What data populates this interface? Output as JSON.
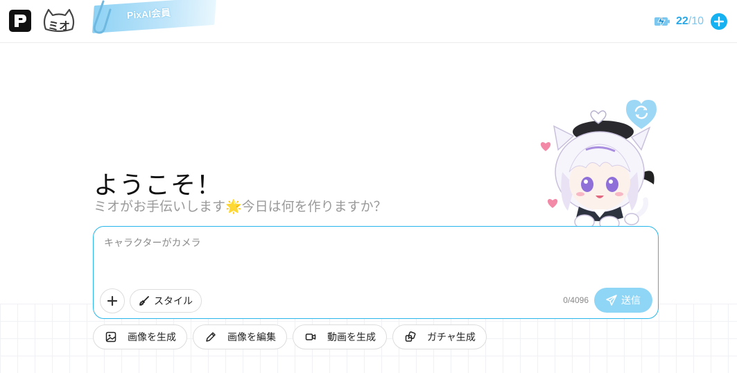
{
  "header": {
    "logo_icon": "pixai-logo-icon",
    "mascot_logo_text": "ミオ",
    "membership_badge": "PixAI会員",
    "credits": {
      "icon": "energy-bolt-icon",
      "current": "22",
      "separator": "/",
      "max": "10",
      "add_icon": "plus-icon"
    }
  },
  "welcome": {
    "title": "ようこそ！",
    "subtitle": "ミオがお手伝いします🌟今日は何を作りますか？"
  },
  "mascot": {
    "refresh_icon": "refresh-heart-icon"
  },
  "prompt": {
    "placeholder": "キャラクターがカメラ",
    "value": "",
    "add_icon": "plus-icon",
    "style_label": "スタイル",
    "style_icon": "brush-icon",
    "char_count": "0/4096",
    "send_label": "送信",
    "send_icon": "paper-plane-icon"
  },
  "actions": [
    {
      "label": "画像を生成",
      "icon": "image-icon"
    },
    {
      "label": "画像を編集",
      "icon": "pencil-icon"
    },
    {
      "label": "動画を生成",
      "icon": "video-icon"
    },
    {
      "label": "ガチャ生成",
      "icon": "gacha-icon"
    }
  ],
  "colors": {
    "accent": "#15b1f0",
    "border_active": "#26b6ec",
    "send_disabled": "#8fd6f6",
    "subtitle": "#9a9a9a"
  }
}
